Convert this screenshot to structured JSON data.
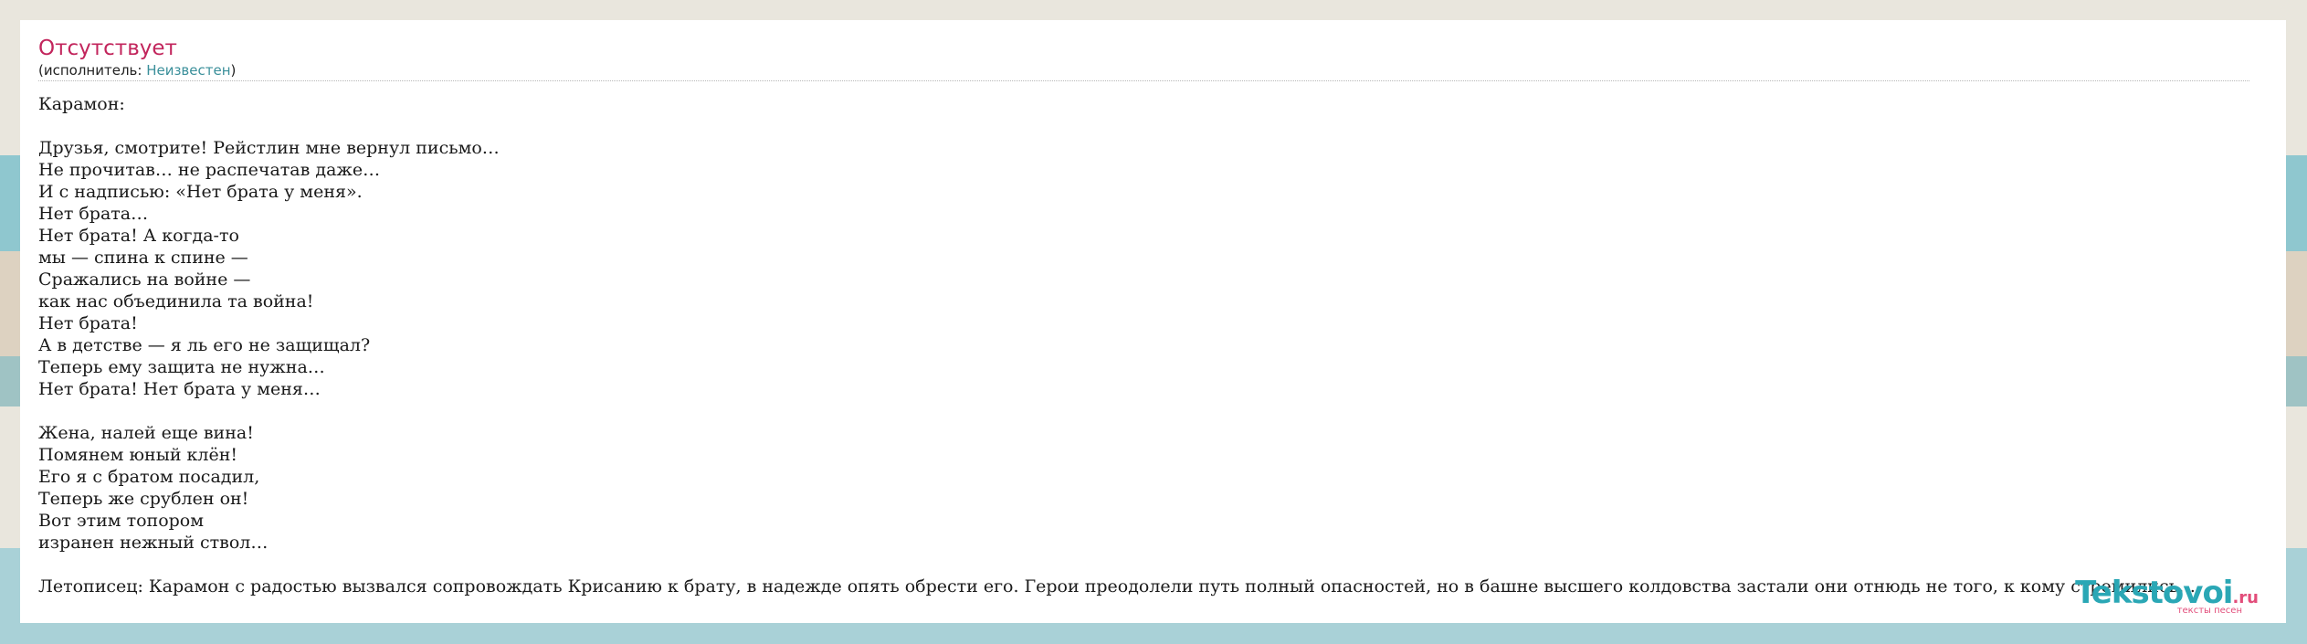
{
  "song": {
    "title": "Отсутствует",
    "performer_prefix": "(исполнитель: ",
    "performer_name": "Неизвестен",
    "performer_suffix": ")"
  },
  "lyrics": {
    "speaker": "Карамон:",
    "verse1": [
      "Друзья, смотрите! Рейстлин мне вернул письмо…",
      "Не прочитав… не распечатав даже…",
      "И с надписью: «Нет брата у меня».",
      "Нет брата…",
      "Нет брата! А когда-то",
      "мы — спина к спине —",
      "Сражались на войне —",
      "как нас объединила та война!",
      "Нет брата!",
      "А в детстве — я ль его не защищал?",
      "Теперь ему защита не нужна…",
      "Нет брата! Нет брата у меня…"
    ],
    "verse2": [
      "Жена, налей еще вина!",
      "Помянем юный клён!",
      "Его я с братом посадил,",
      "Теперь же срублен он!",
      "Вот этим топором",
      "изранен нежный ствол…"
    ],
    "chronicler": "Летописец: Карамон с радостью вызвался сопровождать Крисанию к брату, в надежде опять обрести его. Герои преодолели путь полный опасностей, но в башне высшего колдовства застали они отнюдь не того, к кому стремились…"
  },
  "watermark": {
    "brand": "Tekstovoi",
    "tld": ".ru",
    "tagline": "тексты песен"
  },
  "colors": {
    "title": "#c2255c",
    "link": "#3a8f9a",
    "brand": "#2aa7b5",
    "brand_accent": "#e24d7a"
  }
}
